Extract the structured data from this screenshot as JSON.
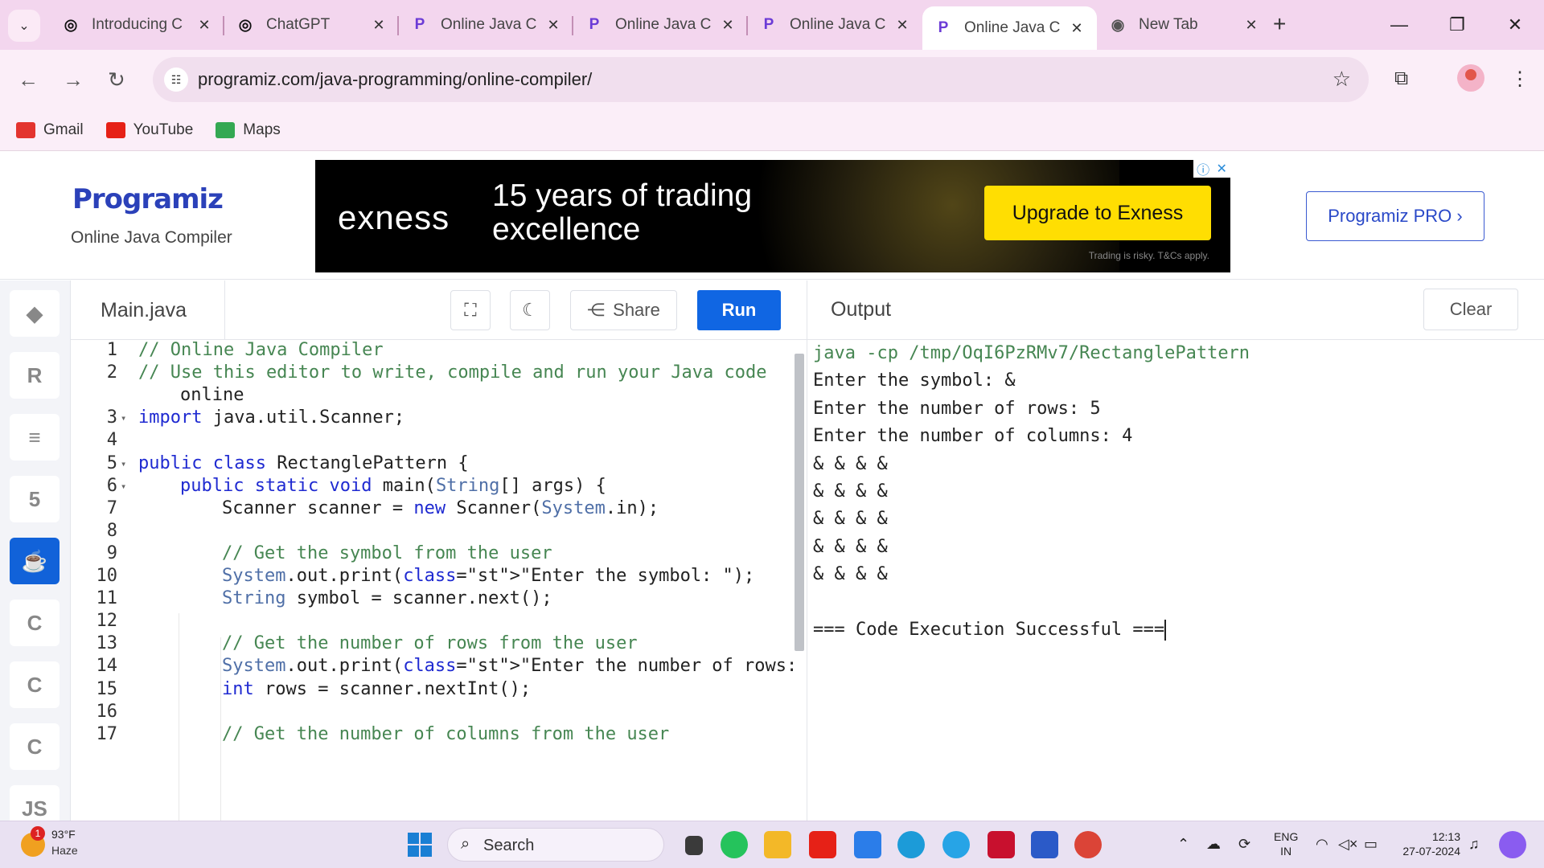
{
  "browser": {
    "tabs": [
      {
        "title": "Introducing C",
        "favicon": "openai-icon",
        "active": false
      },
      {
        "title": "ChatGPT",
        "favicon": "openai-icon",
        "active": false
      },
      {
        "title": "Online Java C",
        "favicon": "programiz-icon",
        "active": false
      },
      {
        "title": "Online Java C",
        "favicon": "programiz-icon",
        "active": false
      },
      {
        "title": "Online Java C",
        "favicon": "programiz-icon",
        "active": false
      },
      {
        "title": "Online Java C",
        "favicon": "programiz-icon",
        "active": true
      },
      {
        "title": "New Tab",
        "favicon": "chrome-icon",
        "active": false
      }
    ],
    "url": "programiz.com/java-programming/online-compiler/",
    "bookmarks": [
      {
        "label": "Gmail",
        "icon": "gmail-icon"
      },
      {
        "label": "YouTube",
        "icon": "youtube-icon"
      },
      {
        "label": "Maps",
        "icon": "maps-icon"
      }
    ]
  },
  "header": {
    "logo": "Programiz",
    "subtitle": "Online Java Compiler",
    "pro_button": "Programiz PRO ›"
  },
  "ad": {
    "brand": "exness",
    "headline": "15 years of trading excellence",
    "cta": "Upgrade to Exness",
    "note": "Trading is risky. T&Cs apply."
  },
  "sidebar": {
    "languages": [
      "python",
      "r",
      "sql",
      "html",
      "java",
      "c",
      "cpp",
      "csharp",
      "js"
    ],
    "active": "java",
    "labels": {
      "js": "JS"
    }
  },
  "editor": {
    "file_name": "Main.java",
    "share_label": "Share",
    "run_label": "Run",
    "lines": [
      {
        "n": "1",
        "text": "// Online Java Compiler"
      },
      {
        "n": "2",
        "text": "// Use this editor to write, compile and run your Java code"
      },
      {
        "n": "",
        "text": "online"
      },
      {
        "n": "3",
        "text": "import java.util.Scanner;"
      },
      {
        "n": "4",
        "text": ""
      },
      {
        "n": "5",
        "text": "public class RectanglePattern {"
      },
      {
        "n": "6",
        "text": "public static void main(String[] args) {"
      },
      {
        "n": "7",
        "text": "Scanner scanner = new Scanner(System.in);"
      },
      {
        "n": "8",
        "text": ""
      },
      {
        "n": "9",
        "text": "// Get the symbol from the user"
      },
      {
        "n": "10",
        "text": "System.out.print(\"Enter the symbol: \");"
      },
      {
        "n": "11",
        "text": "String symbol = scanner.next();"
      },
      {
        "n": "12",
        "text": ""
      },
      {
        "n": "13",
        "text": "// Get the number of rows from the user"
      },
      {
        "n": "14",
        "text": "System.out.print(\"Enter the number of rows: \");"
      },
      {
        "n": "15",
        "text": "int rows = scanner.nextInt();"
      },
      {
        "n": "16",
        "text": ""
      },
      {
        "n": "17",
        "text": "// Get the number of columns from the user"
      }
    ]
  },
  "output": {
    "title": "Output",
    "clear_label": "Clear",
    "lines": [
      "java -cp /tmp/OqI6PzRMv7/RectanglePattern",
      "Enter the symbol: &",
      "Enter the number of rows: 5",
      "Enter the number of columns: 4",
      "& & & &",
      "& & & &",
      "& & & &",
      "& & & &",
      "& & & &",
      "",
      "=== Code Execution Successful ==="
    ]
  },
  "taskbar": {
    "weather_temp": "93°F",
    "weather_desc": "Haze",
    "weather_badge": "1",
    "search_label": "Search",
    "lang_top": "ENG",
    "lang_bottom": "IN",
    "time": "12:13",
    "date": "27-07-2024"
  }
}
